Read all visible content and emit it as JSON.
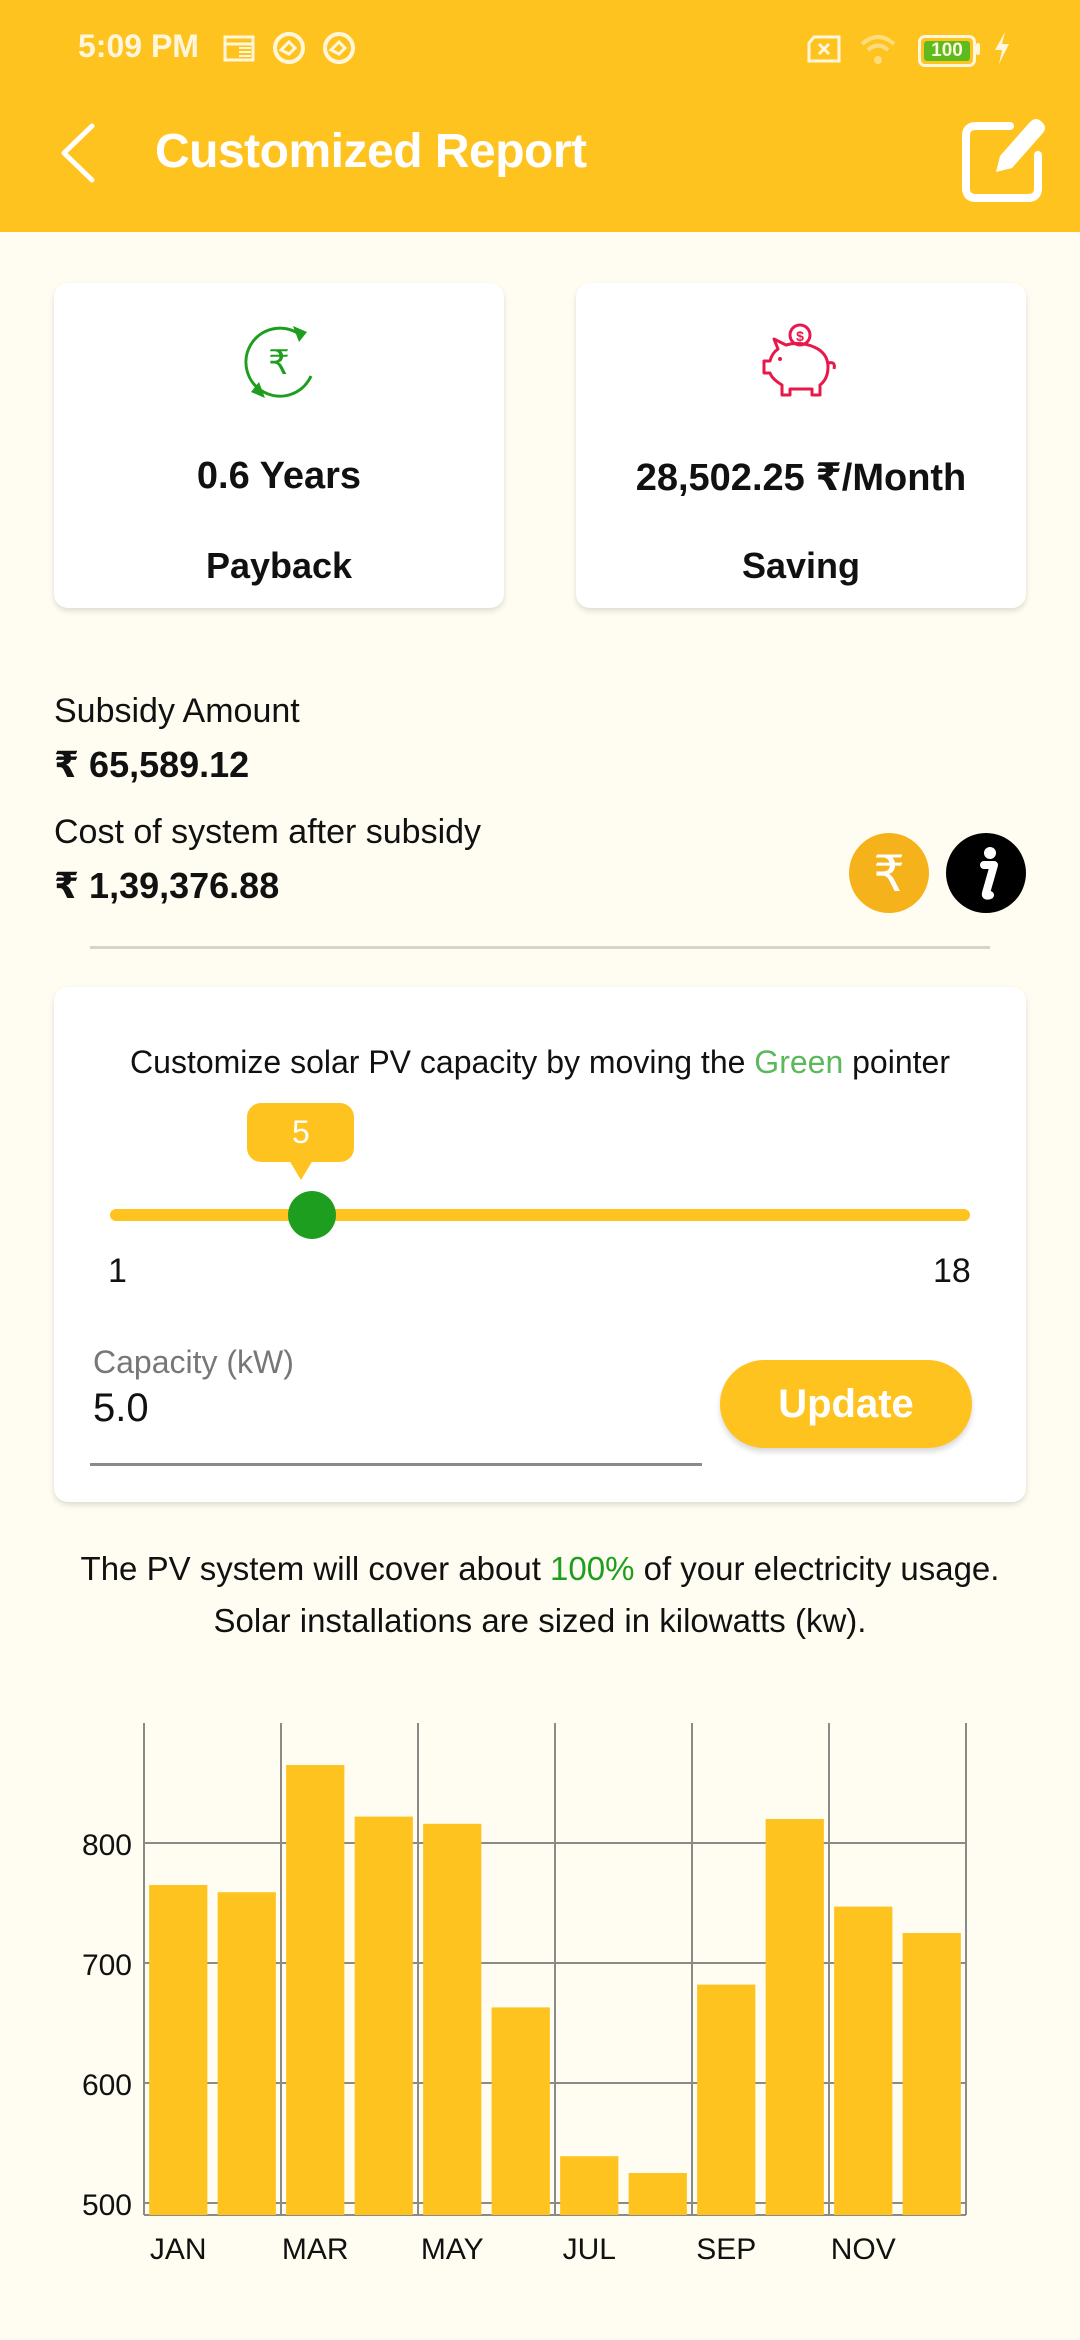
{
  "status_bar": {
    "time": "5:09 PM",
    "left_icons": [
      "calendar-icon",
      "app-notification-icon",
      "app-notification-icon"
    ],
    "right_icons": [
      "no-sim-icon",
      "wifi-icon",
      "battery-icon",
      "charging-icon"
    ],
    "battery_level": "100"
  },
  "header": {
    "title": "Customized Report",
    "back_icon": "chevron-left-icon",
    "edit_icon": "edit-icon"
  },
  "summary_cards": [
    {
      "icon": "rupee-cycle-icon",
      "value": "0.6 Years",
      "label": "Payback"
    },
    {
      "icon": "piggy-bank-icon",
      "value": "28,502.25 ₹/Month",
      "label": "Saving"
    }
  ],
  "subsidy": {
    "subsidy_label": "Subsidy Amount",
    "subsidy_value": "₹ 65,589.12",
    "cost_label": "Cost of system after subsidy",
    "cost_value": "₹ 1,39,376.88",
    "rupee_button_icon": "rupee-icon",
    "info_button_icon": "info-icon"
  },
  "capacity_card": {
    "instruction_pre": "Customize solar PV capacity by moving the ",
    "instruction_highlight": "Green",
    "instruction_post": " pointer",
    "slider": {
      "min": 1,
      "max": 18,
      "value": 5,
      "min_label": "1",
      "max_label": "18",
      "tooltip": "5"
    },
    "input_label": "Capacity (kW)",
    "input_value": "5.0",
    "update_label": "Update"
  },
  "coverage": {
    "line1_pre": "The PV system will cover about ",
    "line1_pct": "100%",
    "line1_post": " of your electricity usage.",
    "line2": "Solar installations are sized in kilowatts (kw)."
  },
  "colors": {
    "primary": "#FFC320",
    "green": "#1E9E1E",
    "piggy": "#E8194A",
    "background": "#FFFDF2"
  },
  "chart_data": {
    "type": "bar",
    "title": "",
    "xlabel": "",
    "ylabel": "",
    "categories": [
      "JAN",
      "FEB",
      "MAR",
      "APR",
      "MAY",
      "JUN",
      "JUL",
      "AUG",
      "SEP",
      "OCT",
      "NOV",
      "DEC"
    ],
    "x_tick_labels": [
      "JAN",
      "",
      "MAR",
      "",
      "MAY",
      "",
      "JUL",
      "",
      "SEP",
      "",
      "NOV",
      ""
    ],
    "values": [
      765,
      759,
      865,
      822,
      816,
      663,
      539,
      525,
      682,
      820,
      747,
      725
    ],
    "y_ticks": [
      500,
      600,
      700,
      800
    ],
    "ylim": [
      490,
      900
    ],
    "grid": true,
    "legend": "none",
    "bar_color": "#FFC320"
  }
}
